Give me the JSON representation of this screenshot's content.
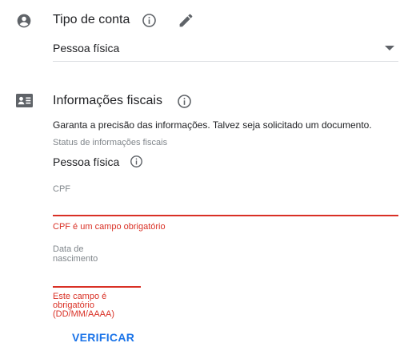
{
  "account_type": {
    "title": "Tipo de conta",
    "selected_value": "Pessoa física",
    "icons": {
      "section": "account-circle-icon",
      "info": "info-icon",
      "edit": "pencil-icon",
      "dropdown": "dropdown-arrow-icon"
    }
  },
  "tax_info": {
    "title": "Informações fiscais",
    "description": "Garanta a precisão das informações. Talvez seja solicitado um documento.",
    "status_label": "Status de informações fiscais",
    "status_value": "Pessoa física",
    "icons": {
      "section": "id-card-icon",
      "info": "info-icon"
    },
    "cpf": {
      "label": "CPF",
      "value": "",
      "error": "CPF é um campo obrigatório"
    },
    "birth_date": {
      "label_line1": "Data de",
      "label_line2": "nascimento",
      "value": "",
      "error_line1": "Este campo é",
      "error_line2": "obrigatório",
      "error_line3": "(DD/MM/AAAA)"
    },
    "verify_label": "VERIFICAR"
  },
  "colors": {
    "error": "#d93025",
    "accent": "#1a73e8",
    "icon": "#5f6368",
    "text": "#202124",
    "muted": "#80868b"
  }
}
